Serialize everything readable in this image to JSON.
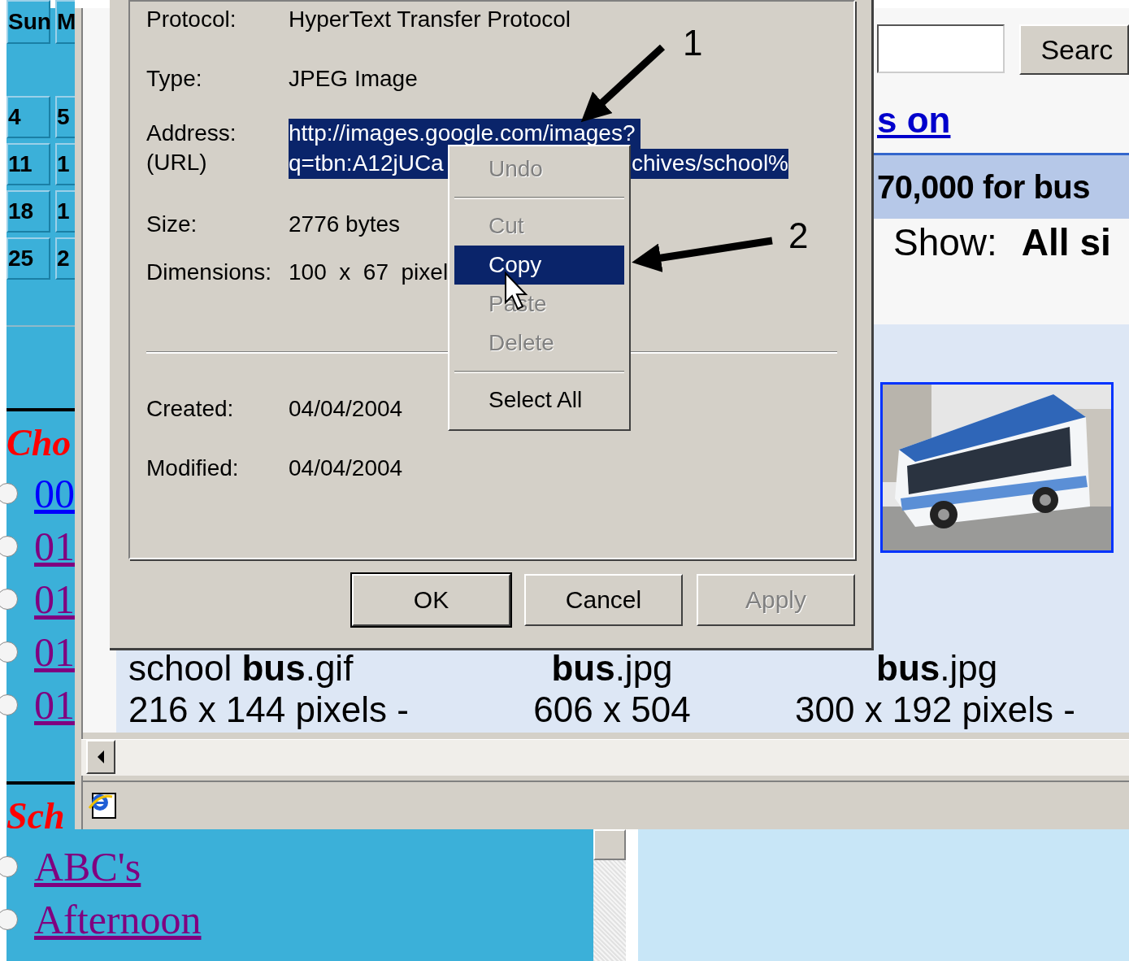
{
  "left_sidebar": {
    "calendar": {
      "headers": [
        "Sun",
        "M"
      ],
      "rows": [
        [
          "4",
          "5"
        ],
        [
          "11",
          "1"
        ],
        [
          "18",
          "1"
        ],
        [
          "25",
          "2"
        ]
      ]
    },
    "sections": [
      {
        "heading": "Cho",
        "items": [
          {
            "label": "00",
            "visited": false,
            "checked": false
          },
          {
            "label": "01",
            "visited": true,
            "checked": false
          },
          {
            "label": "01",
            "visited": true,
            "checked": false
          },
          {
            "label": "01",
            "visited": true,
            "checked": false
          },
          {
            "label": "01",
            "visited": true,
            "checked": false
          }
        ]
      },
      {
        "heading": "Sch",
        "items": [
          {
            "label": "ABC's",
            "visited": true,
            "checked": false
          },
          {
            "label": "Afternoon",
            "visited": true,
            "checked": false
          }
        ]
      }
    ]
  },
  "browser": {
    "search_button": "Searc",
    "link": "s on",
    "result_bar": "70,000 for bus",
    "show_label": "Show:",
    "show_value": "All si",
    "results": [
      {
        "name": "school **bus**.gif",
        "size": "216 x 144 pixels -"
      },
      {
        "name": "**bus**.jpg",
        "size": "606 x 504"
      },
      {
        "name": "**bus**.jpg",
        "size": "300 x 192 pixels -"
      }
    ]
  },
  "dialog": {
    "fields": [
      {
        "kind": "row",
        "label": "Protocol:",
        "value": "HyperText Transfer Protocol"
      },
      {
        "kind": "row",
        "label": "Type:",
        "value": "JPEG Image"
      },
      {
        "kind": "address",
        "label": "Address:",
        "sublabel": "(URL)",
        "selected": true,
        "value_parts": [
          "http://images.google.com/images?",
          "q=tbn:A12jUCa",
          "chives/school%"
        ]
      },
      {
        "kind": "row",
        "label": "Size:",
        "value": "2776 bytes"
      },
      {
        "kind": "row",
        "label": "Dimensions:",
        "value": "100  x  67  pixel"
      },
      {
        "kind": "separator"
      },
      {
        "kind": "row",
        "label": "Created:",
        "value": "04/04/2004"
      },
      {
        "kind": "row",
        "label": "Modified:",
        "value": "04/04/2004"
      }
    ],
    "buttons": [
      {
        "label": "OK",
        "default": true,
        "disabled": false
      },
      {
        "label": "Cancel",
        "default": false,
        "disabled": false
      },
      {
        "label": "Apply",
        "default": false,
        "disabled": true
      }
    ]
  },
  "context_menu": {
    "items": [
      {
        "kind": "item",
        "label": "Undo",
        "disabled": true,
        "selected": false
      },
      {
        "kind": "separator"
      },
      {
        "kind": "item",
        "label": "Cut",
        "disabled": true,
        "selected": false
      },
      {
        "kind": "item",
        "label": "Copy",
        "disabled": false,
        "selected": true
      },
      {
        "kind": "item",
        "label": "Paste",
        "disabled": true,
        "selected": false
      },
      {
        "kind": "item",
        "label": "Delete",
        "disabled": true,
        "selected": false
      },
      {
        "kind": "separator"
      },
      {
        "kind": "item",
        "label": "Select All",
        "disabled": false,
        "selected": false
      }
    ]
  },
  "annotations": [
    {
      "label": "1"
    },
    {
      "label": "2"
    }
  ]
}
